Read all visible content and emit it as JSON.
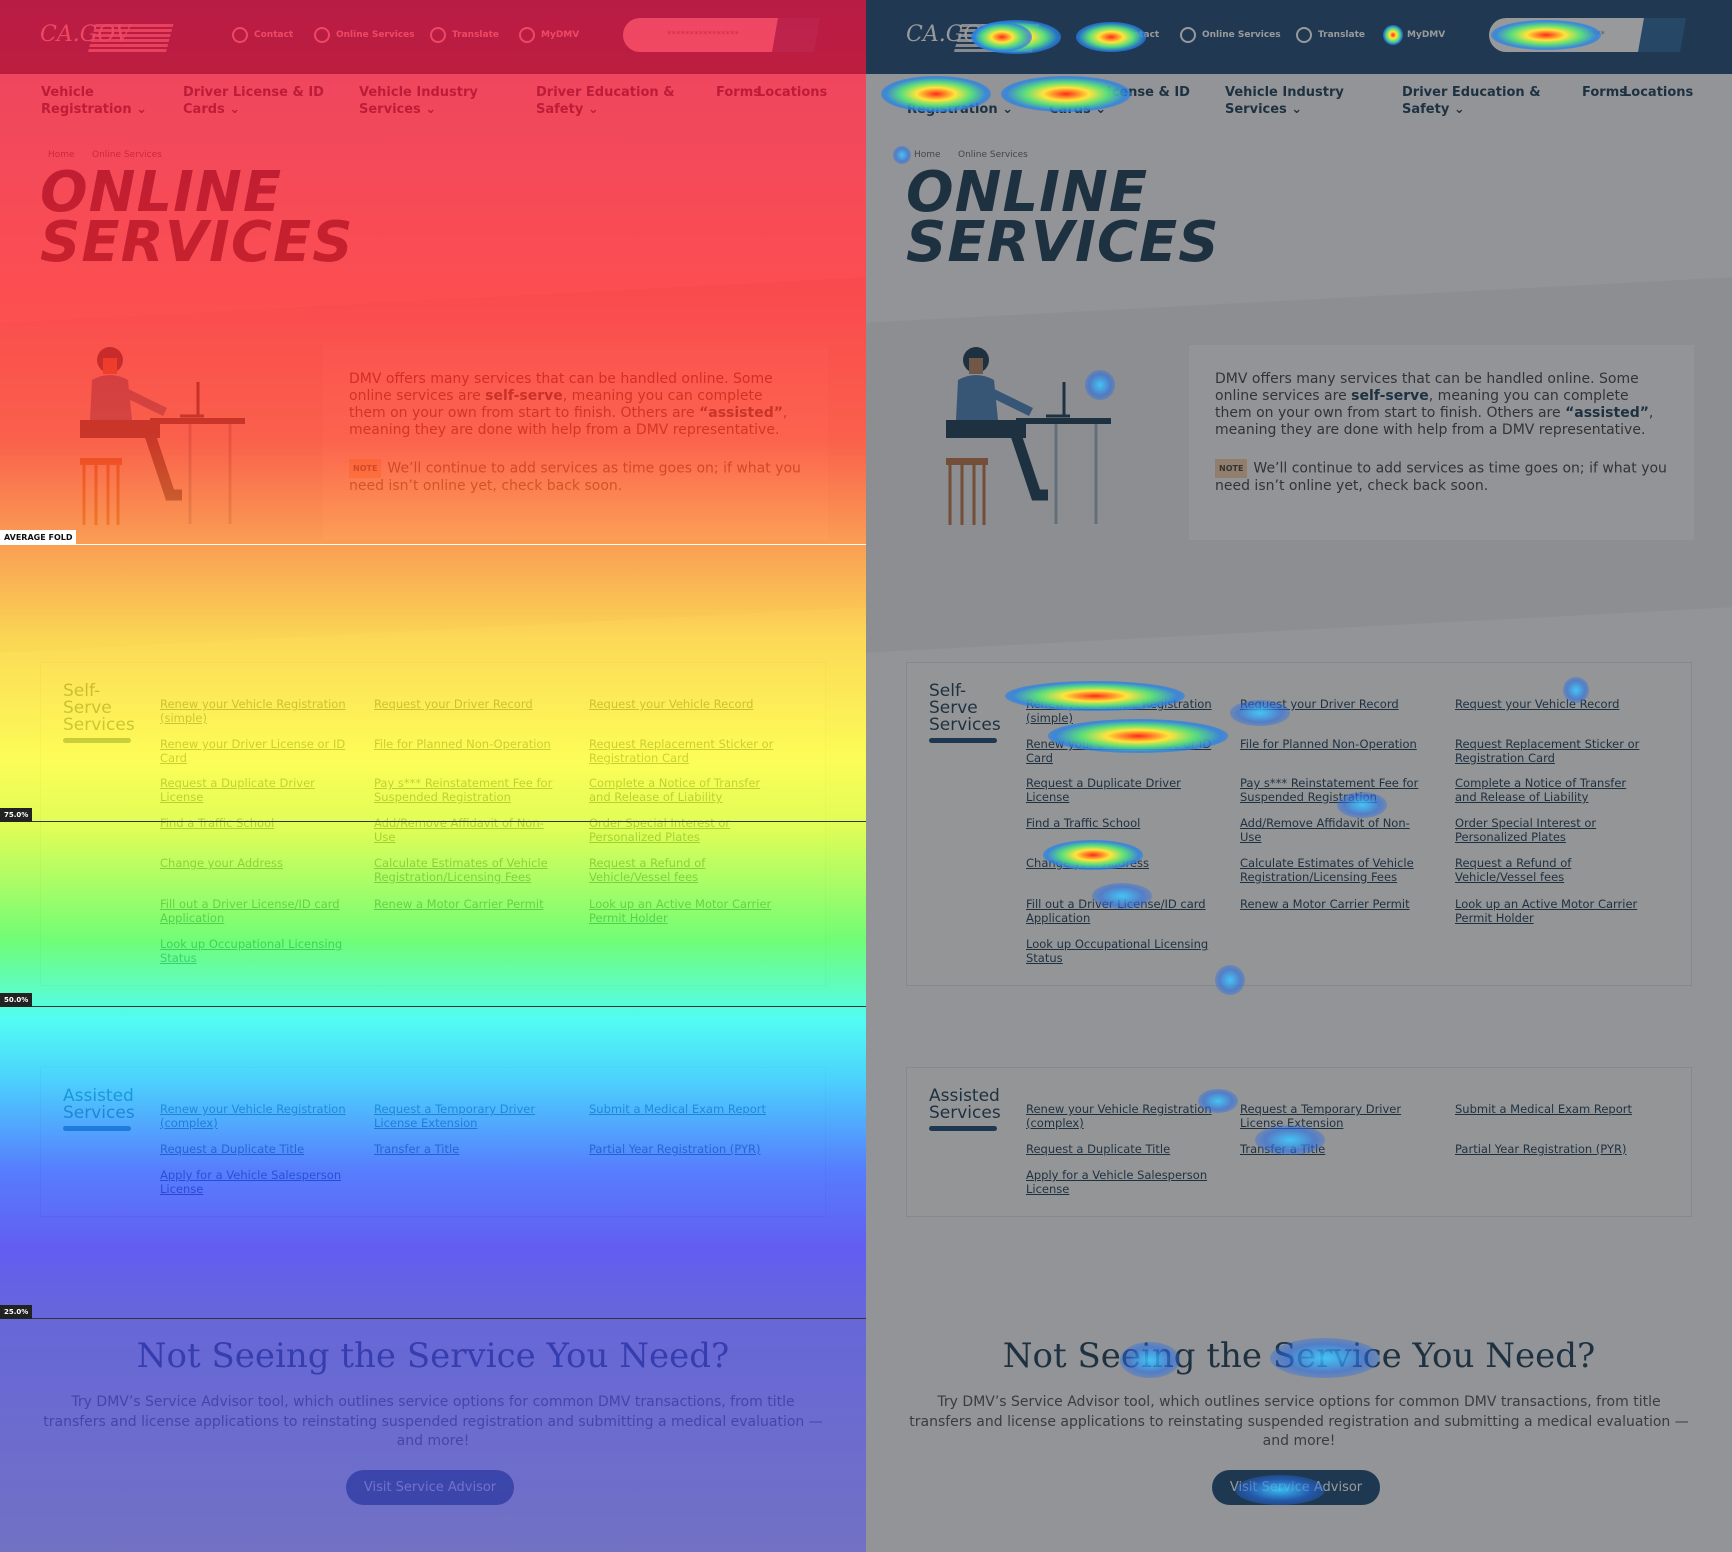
{
  "header": {
    "logo_ca": "CA.GOV",
    "logo_dmv": "DMV",
    "util": [
      {
        "label": "Contact",
        "icon": "mail-icon"
      },
      {
        "label": "Online Services",
        "icon": "gear-icon"
      },
      {
        "label": "Translate",
        "icon": "globe-icon"
      },
      {
        "label": "MyDMV",
        "icon": "user-icon"
      }
    ],
    "search_placeholder": "****************"
  },
  "nav": [
    {
      "label": "Vehicle Registration ⌄"
    },
    {
      "label": "Driver License & ID Cards ⌄"
    },
    {
      "label": "Vehicle Industry Services ⌄"
    },
    {
      "label": "Driver Education & Safety ⌄"
    },
    {
      "label": "Forms"
    },
    {
      "label": "Locations"
    }
  ],
  "breadcrumb": [
    "Home",
    "Online Services"
  ],
  "title": "ONLINE SERVICES",
  "intro": {
    "p1a": "DMV offers many services that can be handled online. Some online services are ",
    "b1": "self-serve",
    "p1b": ", meaning you can complete them on your own from start to finish. Others are ",
    "b2": "“assisted”",
    "p1c": ", meaning they are done with help from a DMV representative.",
    "note_tag": "NOTE",
    "note": "We’ll continue to add services as time goes on; if what you need isn’t online yet, check back soon."
  },
  "self_serve": {
    "title": "Self-Serve Services",
    "links": [
      "Renew your Vehicle Registration (simple)",
      "Request your Driver Record",
      "Request your Vehicle Record",
      "Renew your Driver License or ID Card",
      "File for Planned Non-Operation",
      "Request Replacement Sticker or Registration Card",
      "Request a Duplicate Driver License",
      "Pay s*** Reinstatement Fee for Suspended Registration",
      "Complete a Notice of Transfer and Release of Liability",
      "Find a Traffic School",
      "Add/Remove Affidavit of Non-Use",
      "Order Special Interest or Personalized Plates",
      "Change your Address",
      "Calculate Estimates of Vehicle Registration/Licensing Fees",
      "Request a Refund of Vehicle/Vessel fees",
      "Fill out a Driver License/ID card Application",
      "Renew a Motor Carrier Permit",
      "Look up an Active Motor Carrier Permit Holder",
      "Look up Occupational Licensing Status"
    ]
  },
  "assisted": {
    "title": "Assisted Services",
    "links": [
      "Renew your Vehicle Registration (complex)",
      "Request a Temporary Driver License Extension",
      "Submit a Medical Exam Report",
      "Request a Duplicate Title",
      "Transfer a Title",
      "Partial Year Registration (PYR)",
      "Apply for a Vehicle Salesperson License"
    ]
  },
  "advisor": {
    "heading": "Not Seeing the Service You Need?",
    "text": "Try DMV’s Service Advisor tool, which outlines service options for common DMV transactions, from title transfers and license applications to reinstating suspended registration and submitting a medical evaluation — and more!",
    "button": "Visit Service Advisor"
  },
  "folds": {
    "average": "AVERAGE FOLD",
    "p75": "75.0%",
    "p50": "50.0%",
    "p25": "25.0%"
  },
  "colors": {
    "header": "#0f3d6b",
    "text": "#0b2f4a",
    "accent": "#0b3d6b"
  }
}
